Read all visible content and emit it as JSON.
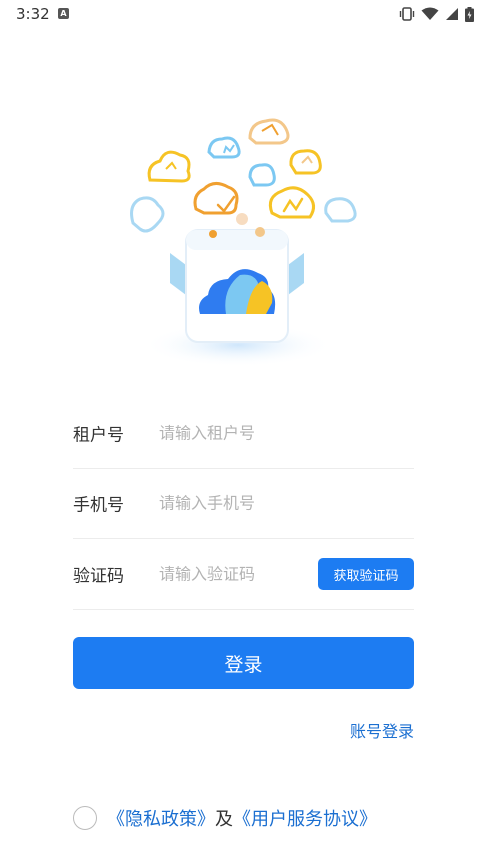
{
  "status_bar": {
    "time": "3:32",
    "notification_icon": "a-badge-icon",
    "icons": [
      "vibrate-icon",
      "wifi-icon",
      "signal-icon",
      "battery-icon"
    ]
  },
  "illustration": {
    "icon": "cloud-app-illustration",
    "colors": {
      "blue": "#2f7cf0",
      "light_blue": "#7cc8f2",
      "yellow": "#f6c325",
      "orange": "#f0a030"
    }
  },
  "form": {
    "tenant": {
      "label": "租户号",
      "placeholder": "请输入租户号",
      "value": ""
    },
    "phone": {
      "label": "手机号",
      "placeholder": "请输入手机号",
      "value": ""
    },
    "code": {
      "label": "验证码",
      "placeholder": "请输入验证码",
      "value": "",
      "button": "获取验证码"
    }
  },
  "login_button": "登录",
  "account_login_link": "账号登录",
  "agreement": {
    "privacy": "《隐私政策》",
    "and": "及",
    "service": "《用户服务协议》",
    "checked": false
  },
  "theme": {
    "primary": "#1d7cf2",
    "link": "#1b6fd1"
  }
}
